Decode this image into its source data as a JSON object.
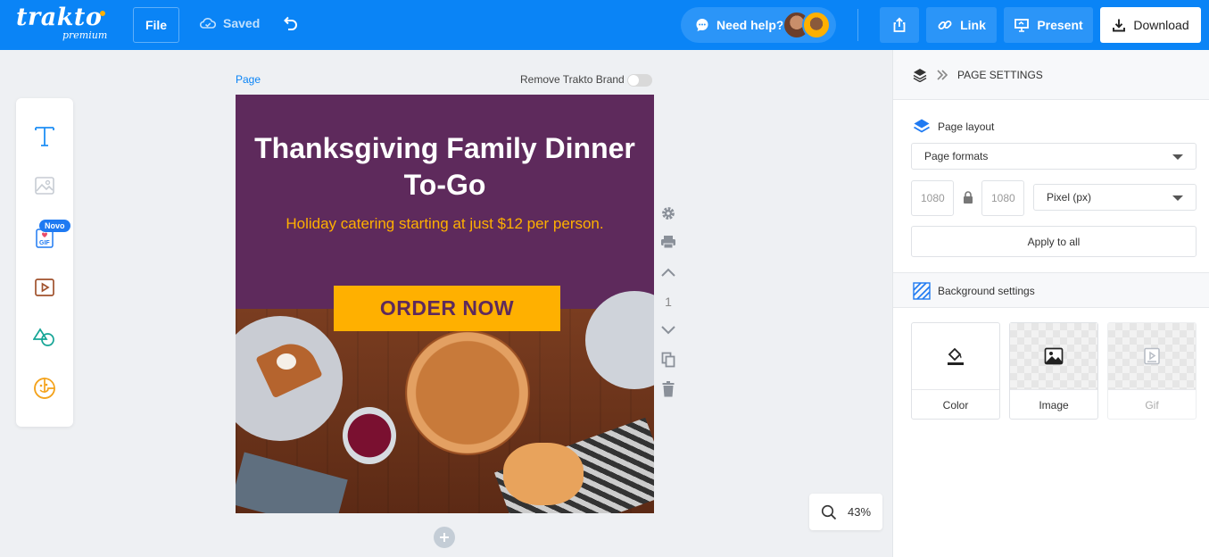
{
  "topbar": {
    "logo": "trakto",
    "logo_sub": "premium",
    "file_label": "File",
    "saved_label": "Saved",
    "help_label": "Need help?",
    "link_label": "Link",
    "present_label": "Present",
    "download_label": "Download",
    "brand_color": "#0a84f6"
  },
  "tools": {
    "novo_badge": "Novo",
    "items": [
      "text-tool",
      "image-tool",
      "gif-tool",
      "video-tool",
      "shapes-tool",
      "stickers-tool"
    ]
  },
  "page": {
    "label": "Page",
    "remove_brand_label": "Remove Trakto Brand",
    "page_number": "1"
  },
  "design": {
    "headline": "Thanksgiving Family Dinner To-Go",
    "subline": "Holiday catering starting at just $12 per person.",
    "cta": "ORDER NOW",
    "bg_color": "#5e2a5c",
    "accent_color": "#ffb000"
  },
  "zoom": {
    "value": "43%"
  },
  "panel": {
    "title": "PAGE SETTINGS",
    "layout_title": "Page layout",
    "page_formats": "Page formats",
    "width_value": "1080",
    "height_value": "1080",
    "unit": "Pixel (px)",
    "apply_label": "Apply to all",
    "background_title": "Background settings",
    "bg_options": [
      "Color",
      "Image",
      "Gif"
    ]
  }
}
